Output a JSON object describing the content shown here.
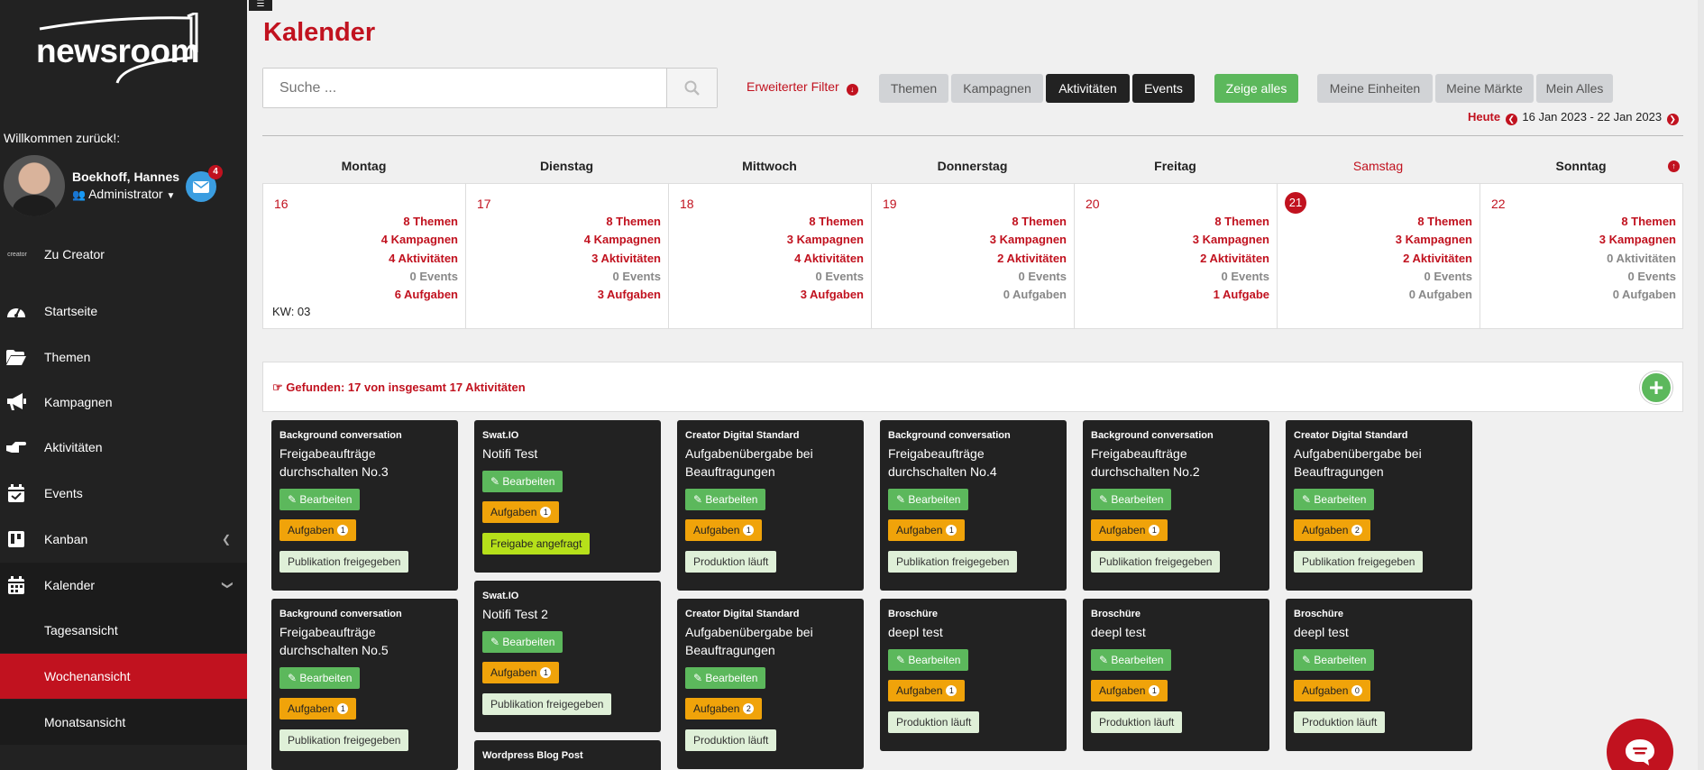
{
  "app": {
    "logo_text": "newsroom"
  },
  "sidebar": {
    "welcome": "Willkommen zurück!:",
    "user_name": "Boekhoff, Hannes",
    "user_role": "Administrator",
    "mail_count": "4",
    "creator_label": "Zu Creator",
    "creator_icon_text": "creator",
    "items": [
      {
        "label": "Startseite",
        "icon": "dashboard-icon"
      },
      {
        "label": "Themen",
        "icon": "folder-icon"
      },
      {
        "label": "Kampagnen",
        "icon": "bullhorn-icon"
      },
      {
        "label": "Aktivitäten",
        "icon": "hand-point-icon"
      },
      {
        "label": "Events",
        "icon": "calendar-check-icon"
      },
      {
        "label": "Kanban",
        "icon": "kanban-icon"
      },
      {
        "label": "Kalender",
        "icon": "calendar-icon"
      },
      {
        "label": "Tagesansicht"
      },
      {
        "label": "Wochenansicht"
      },
      {
        "label": "Monatsansicht"
      }
    ]
  },
  "header": {
    "title": "Kalender",
    "search_placeholder": "Suche ...",
    "extended_filter": "Erweiterter Filter",
    "filters": [
      "Themen",
      "Kampagnen",
      "Aktivitäten",
      "Events"
    ],
    "show_all": "Zeige alles",
    "scope": [
      "Meine Einheiten",
      "Meine Märkte",
      "Mein Alles"
    ],
    "today": "Heute",
    "range": "16 Jan 2023 - 22 Jan 2023"
  },
  "calendar": {
    "days": [
      {
        "name": "Montag",
        "num": "16",
        "themen": "8 Themen",
        "kampagnen": "4 Kampagnen",
        "aktivitaeten": "4 Aktivitäten",
        "events": "0 Events",
        "aufgaben": "6 Aufgaben"
      },
      {
        "name": "Dienstag",
        "num": "17",
        "themen": "8 Themen",
        "kampagnen": "4 Kampagnen",
        "aktivitaeten": "3 Aktivitäten",
        "events": "0 Events",
        "aufgaben": "3 Aufgaben"
      },
      {
        "name": "Mittwoch",
        "num": "18",
        "themen": "8 Themen",
        "kampagnen": "3 Kampagnen",
        "aktivitaeten": "4 Aktivitäten",
        "events": "0 Events",
        "aufgaben": "3 Aufgaben"
      },
      {
        "name": "Donnerstag",
        "num": "19",
        "themen": "8 Themen",
        "kampagnen": "3 Kampagnen",
        "aktivitaeten": "2 Aktivitäten",
        "events": "0 Events",
        "aufgaben": "0 Aufgaben"
      },
      {
        "name": "Freitag",
        "num": "20",
        "themen": "8 Themen",
        "kampagnen": "3 Kampagnen",
        "aktivitaeten": "2 Aktivitäten",
        "events": "0 Events",
        "aufgaben": "1 Aufgabe"
      },
      {
        "name": "Samstag",
        "num": "21",
        "themen": "8 Themen",
        "kampagnen": "3 Kampagnen",
        "aktivitaeten": "2 Aktivitäten",
        "events": "0 Events",
        "aufgaben": "0 Aufgaben"
      },
      {
        "name": "Sonntag",
        "num": "22",
        "themen": "8 Themen",
        "kampagnen": "3 Kampagnen",
        "aktivitaeten": "0 Aktivitäten",
        "events": "0 Events",
        "aufgaben": "0 Aufgaben"
      }
    ],
    "kw": "KW: 03"
  },
  "results": {
    "found": "Gefunden: 17 von insgesamt 17 Aktivitäten",
    "edit_label": "Bearbeiten",
    "tasks_label": "Aufgaben",
    "cards": [
      {
        "cat": "Background conversation",
        "title": "Freigabeaufträge durchschalten No.3",
        "tasks": "1",
        "status": "Publikation freigegeben"
      },
      {
        "cat": "Background conversation",
        "title": "Freigabeaufträge durchschalten No.5",
        "tasks": "1",
        "status": "Publikation freigegeben"
      },
      {
        "cat": "Swat.IO",
        "title": "Notifi Test",
        "tasks": "1",
        "status": "Freigabe angefragt"
      },
      {
        "cat": "Swat.IO",
        "title": "Notifi Test 2",
        "tasks": "1",
        "status": "Publikation freigegeben"
      },
      {
        "cat": "Wordpress Blog Post"
      },
      {
        "cat": "Creator Digital Standard",
        "title": "Aufgabenübergabe bei Beauftragungen",
        "tasks": "1",
        "status": "Produktion läuft"
      },
      {
        "cat": "Creator Digital Standard",
        "title": "Aufgabenübergabe bei Beauftragungen",
        "tasks": "2",
        "status": "Produktion läuft"
      },
      {
        "cat": "Background conversation",
        "title": "Freigabeaufträge durchschalten No.4",
        "tasks": "1",
        "status": "Publikation freigegeben"
      },
      {
        "cat": "Broschüre",
        "title": "deepl test",
        "tasks": "1",
        "status": "Produktion läuft"
      },
      {
        "cat": "Background conversation",
        "title": "Freigabeaufträge durchschalten No.2",
        "tasks": "1",
        "status": "Publikation freigegeben"
      },
      {
        "cat": "Broschüre",
        "title": "deepl test",
        "tasks": "1",
        "status": "Produktion läuft"
      },
      {
        "cat": "Creator Digital Standard",
        "title": "Aufgabenübergabe bei Beauftragungen",
        "tasks": "2",
        "status": "Publikation freigegeben"
      },
      {
        "cat": "Broschüre",
        "title": "deepl test",
        "tasks": "0",
        "status": "Produktion läuft"
      }
    ]
  }
}
